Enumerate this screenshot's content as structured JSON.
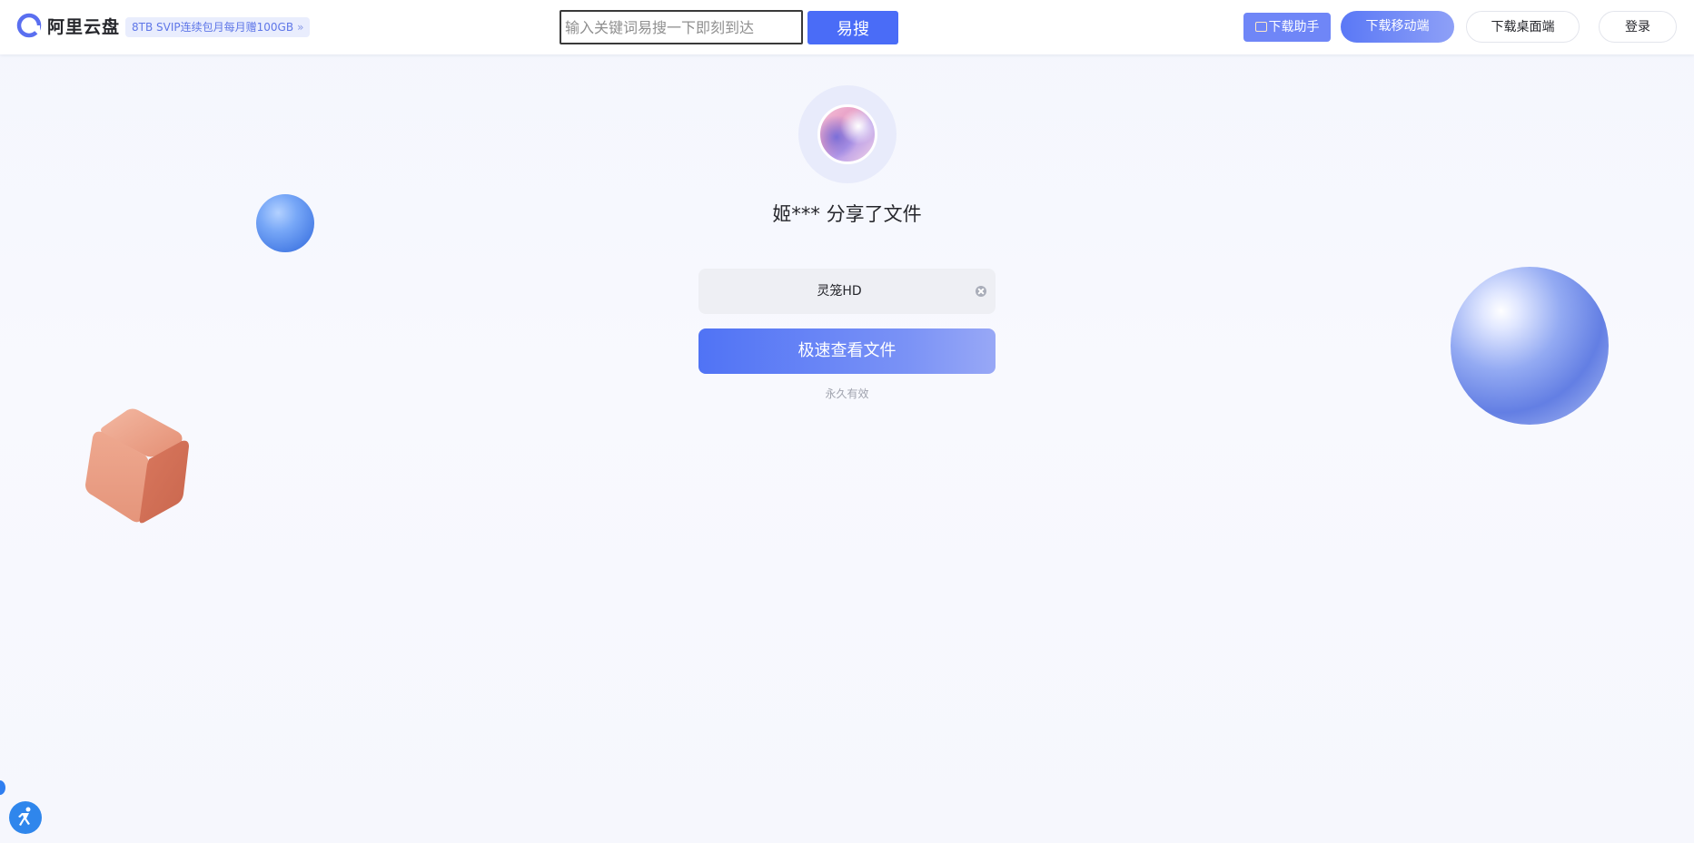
{
  "header": {
    "logo_text": "阿里云盘",
    "promo_text": "8TB SVIP连续包月每月赠100GB",
    "promo_chevron": "»",
    "search": {
      "placeholder": "输入关键词易搜一下即刻到达",
      "value": ""
    },
    "search_button": "易搜",
    "buttons": {
      "assistant": "下载助手",
      "mobile": "下载移动端",
      "desktop": "下载桌面端",
      "login": "登录"
    }
  },
  "share": {
    "title": "姬*** 分享了文件",
    "code_value": "灵笼HD",
    "view_button": "极速查看文件",
    "validity": "永久有效"
  },
  "colors": {
    "primary": "#4a6cf7",
    "brand_gradient_start": "#5073f5",
    "brand_gradient_end": "#98a8f6",
    "promo_text": "#5f77e8"
  },
  "icons": {
    "logo": "aliyun-drive-logo-icon",
    "clear": "clear-circle-icon",
    "assistant": "download-assistant-icon",
    "accessibility": "accessibility-icon"
  }
}
